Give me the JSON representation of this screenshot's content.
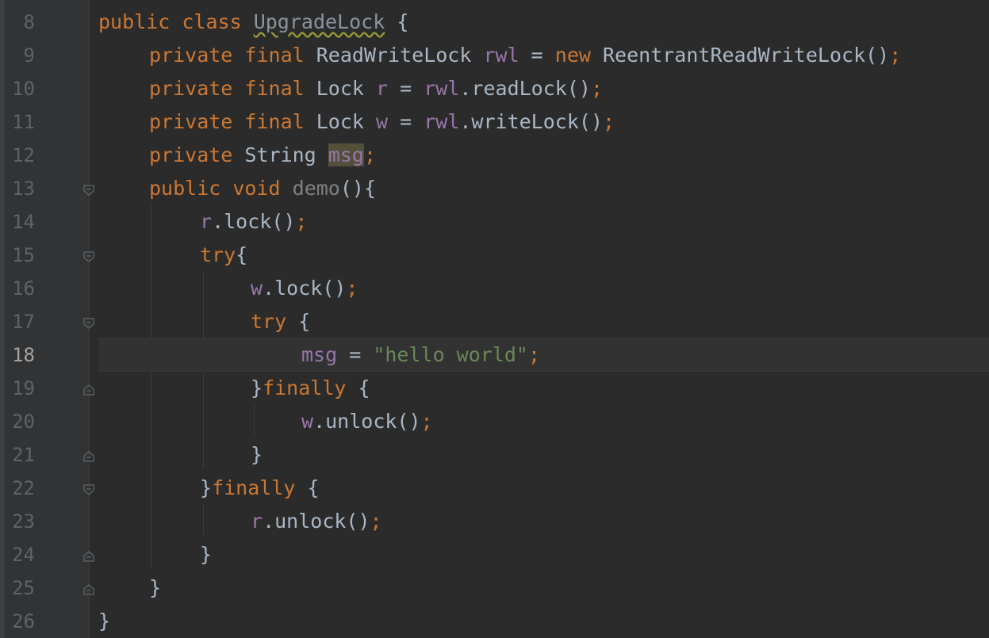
{
  "editor": {
    "current_line": "18",
    "lines": [
      {
        "num": "8",
        "t": {
          "a": "public",
          "b": " ",
          "c": "class",
          "d": " ",
          "e": "UpgradeLock",
          "f": " {"
        }
      },
      {
        "num": "9",
        "t": {
          "a": "private",
          "b": " ",
          "c": "final",
          "d": " ReadWriteLock ",
          "e": "rwl",
          "f": " = ",
          "g": "new",
          "h": " ReentrantReadWriteLock()",
          "i": ";"
        }
      },
      {
        "num": "10",
        "t": {
          "a": "private",
          "b": " ",
          "c": "final",
          "d": " Lock ",
          "e": "r",
          "f": " = ",
          "g": "rwl",
          "h": ".readLock()",
          "i": ";"
        }
      },
      {
        "num": "11",
        "t": {
          "a": "private",
          "b": " ",
          "c": "final",
          "d": " Lock ",
          "e": "w",
          "f": " = ",
          "g": "rwl",
          "h": ".writeLock()",
          "i": ";"
        }
      },
      {
        "num": "12",
        "t": {
          "a": "private",
          "b": " String ",
          "c": "msg",
          "d": ";"
        }
      },
      {
        "num": "13",
        "t": {
          "a": "public",
          "b": " ",
          "c": "void",
          "d": " ",
          "e": "demo",
          "f": "(){"
        }
      },
      {
        "num": "14",
        "t": {
          "a": "r",
          "b": ".lock()",
          "c": ";"
        }
      },
      {
        "num": "15",
        "t": {
          "a": "try",
          "b": "{"
        }
      },
      {
        "num": "16",
        "t": {
          "a": "w",
          "b": ".lock()",
          "c": ";"
        }
      },
      {
        "num": "17",
        "t": {
          "a": "try",
          "b": " {"
        }
      },
      {
        "num": "18",
        "t": {
          "a": "msg",
          "b": " = ",
          "c": "\"hello world\"",
          "d": ";"
        }
      },
      {
        "num": "19",
        "t": {
          "a": "}",
          "b": "finally",
          "c": " {"
        }
      },
      {
        "num": "20",
        "t": {
          "a": "w",
          "b": ".unlock()",
          "c": ";"
        }
      },
      {
        "num": "21",
        "t": {
          "a": "}"
        }
      },
      {
        "num": "22",
        "t": {
          "a": "}",
          "b": "finally",
          "c": " {"
        }
      },
      {
        "num": "23",
        "t": {
          "a": "r",
          "b": ".unlock()",
          "c": ";"
        }
      },
      {
        "num": "24",
        "t": {
          "a": "}"
        }
      },
      {
        "num": "25",
        "t": {
          "a": "}"
        }
      },
      {
        "num": "26",
        "t": {
          "a": "}"
        }
      }
    ]
  },
  "colors": {
    "background": "#2b2b2b",
    "gutter": "#313335",
    "keyword": "#cc7832",
    "field": "#9876aa",
    "string": "#6a8759",
    "text": "#a9b7c6",
    "line_number": "#606366"
  }
}
